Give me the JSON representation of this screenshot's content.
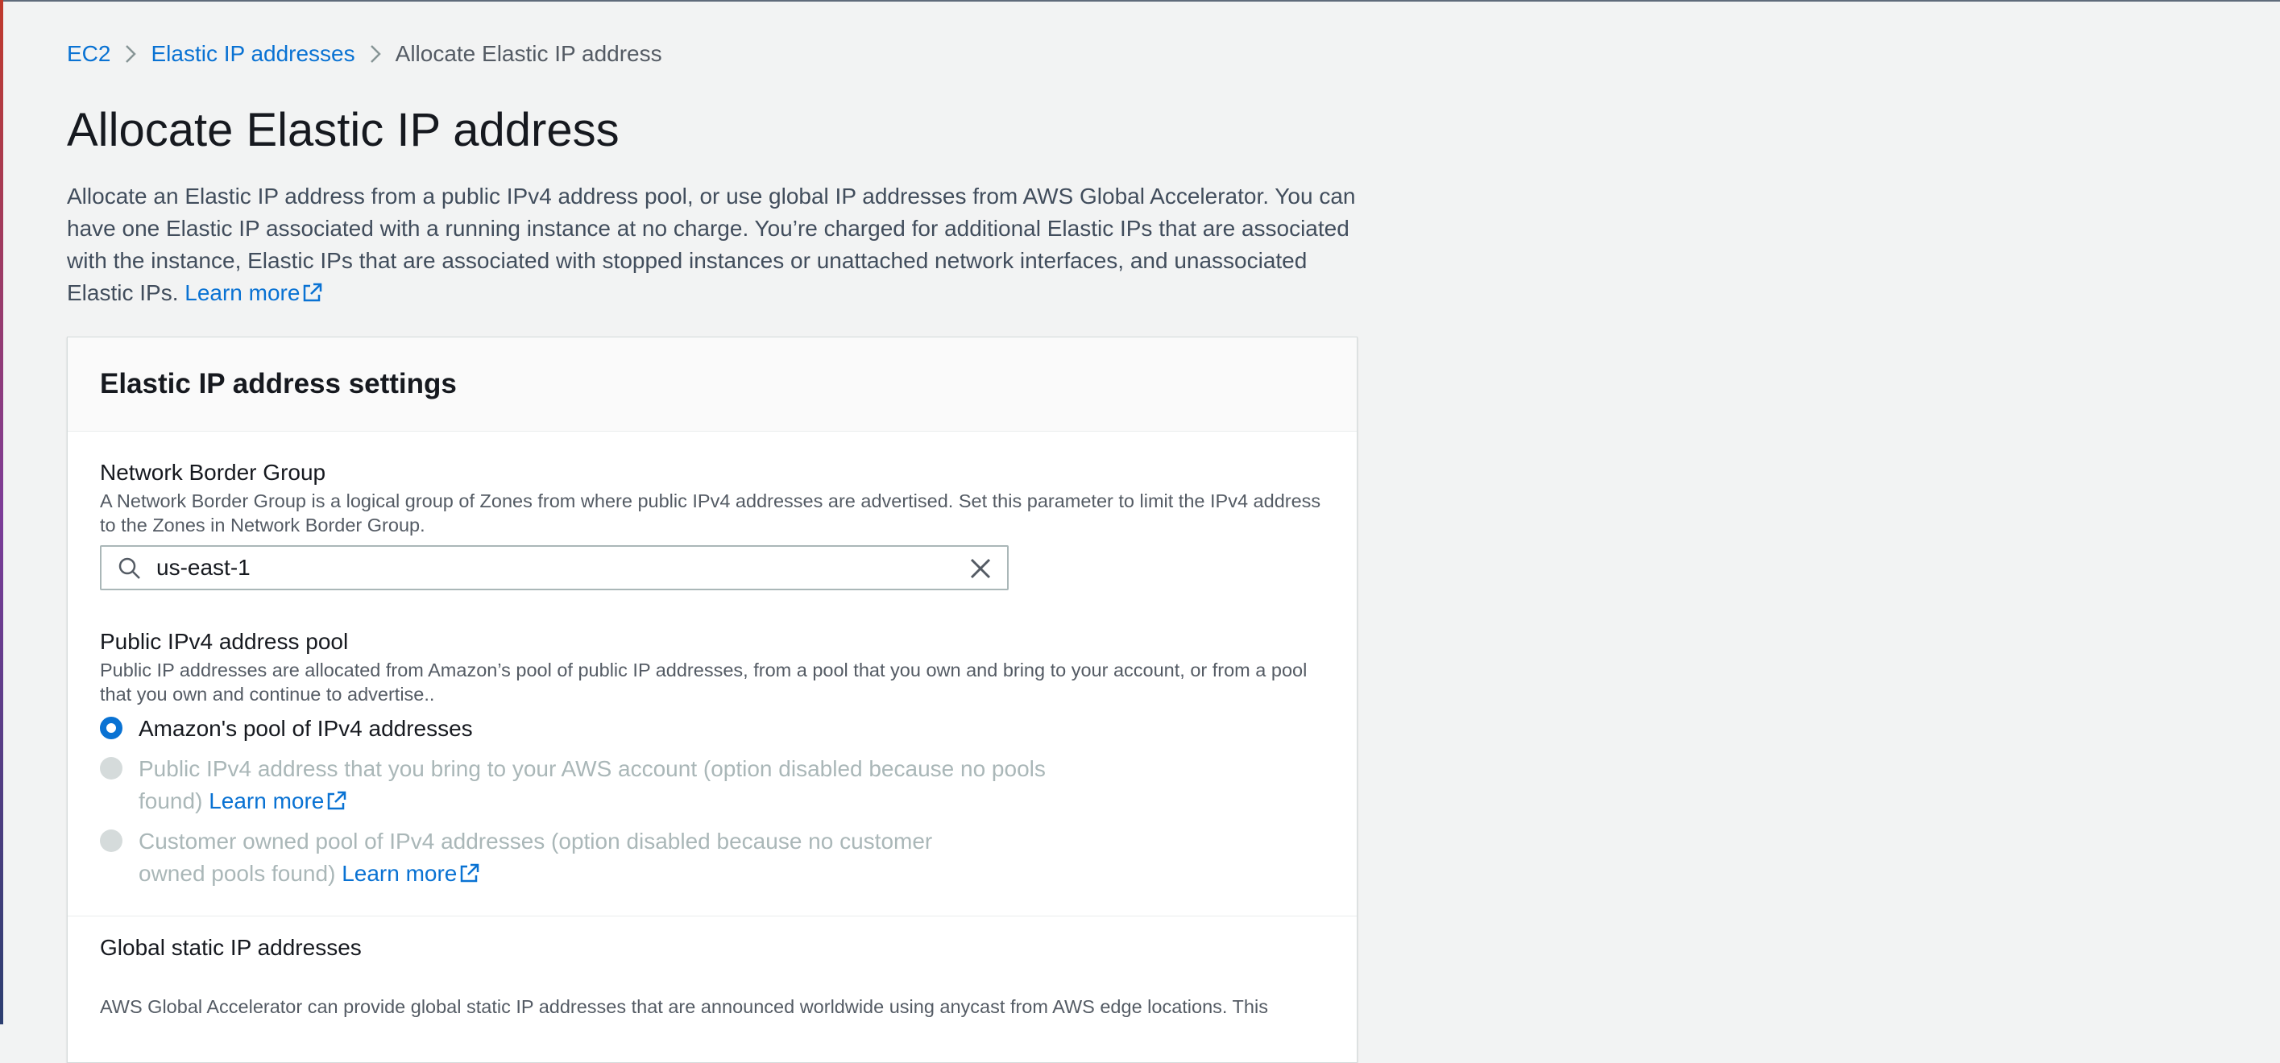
{
  "breadcrumb": {
    "items": [
      {
        "label": "EC2"
      },
      {
        "label": "Elastic IP addresses"
      },
      {
        "label": "Allocate Elastic IP address"
      }
    ]
  },
  "page": {
    "title": "Allocate Elastic IP address",
    "description": "Allocate an Elastic IP address from a public IPv4 address pool, or use global IP addresses from AWS Global Accelerator. You can have one Elastic IP associated with a running instance at no charge. You’re charged for additional Elastic IPs that are associated with the instance, Elastic IPs that are associated with stopped instances or unattached network interfaces, and unassociated Elastic IPs.",
    "learn_more": "Learn more"
  },
  "settings": {
    "title": "Elastic IP address settings",
    "network_border_group": {
      "label": "Network Border Group",
      "description": "A Network Border Group is a logical group of Zones from where public IPv4 addresses are advertised. Set this parameter to limit the IPv4 address to the Zones in Network Border Group.",
      "value": "us-east-1"
    },
    "ipv4_pool": {
      "label": "Public IPv4 address pool",
      "description": "Public IP addresses are allocated from Amazon’s pool of public IP addresses, from a pool that you own and bring to your account, or from a pool that you own and continue to advertise..",
      "options": [
        {
          "label": "Amazon's pool of IPv4 addresses",
          "selected": true,
          "disabled": false
        },
        {
          "label": "Public IPv4 address that you bring to your AWS account (option disabled because no pools found)",
          "learn_more": "Learn more",
          "selected": false,
          "disabled": true
        },
        {
          "label": "Customer owned pool of IPv4 addresses (option disabled because no customer owned pools found)",
          "learn_more": "Learn more",
          "selected": false,
          "disabled": true
        }
      ]
    },
    "global_static": {
      "title": "Global static IP addresses",
      "description": "AWS Global Accelerator can provide global static IP addresses that are announced worldwide using anycast from AWS edge locations. This"
    }
  },
  "icons": {
    "breadcrumb_separator": "chevron-right-icon",
    "external_link": "external-link-icon",
    "search": "search-icon",
    "clear": "close-icon"
  },
  "colors": {
    "link": "#0972d3",
    "radio_selected": "#0972d3",
    "disabled_text": "#aab7b8",
    "background": "#f2f3f3"
  }
}
